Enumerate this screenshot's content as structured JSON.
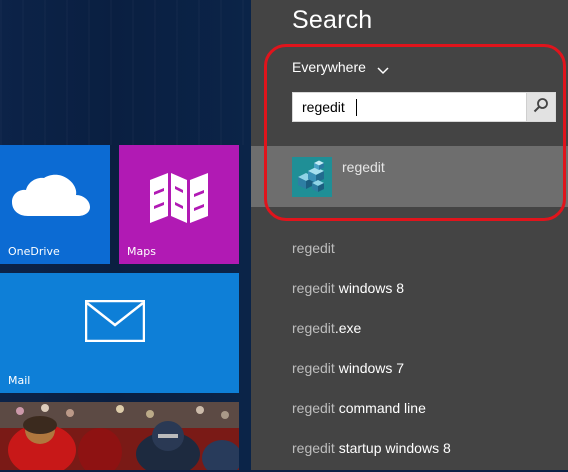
{
  "start_screen": {
    "tiles": [
      {
        "label": "OneDrive",
        "icon": "cloud-icon",
        "color": "#0c6bd3"
      },
      {
        "label": "Maps",
        "icon": "map-icon",
        "color": "#b11ab4"
      },
      {
        "label": "Mail",
        "icon": "envelope-icon",
        "color": "#0e7fd7"
      },
      {
        "label": "",
        "icon": "photo-image",
        "color": "#9b1010"
      }
    ]
  },
  "search_charm": {
    "title": "Search",
    "scope": "Everywhere",
    "query": "regedit",
    "search_button_icon": "search-icon",
    "best_match": {
      "label": "regedit",
      "icon": "registry-editor-icon"
    },
    "suggestions": [
      {
        "typed": "regedit",
        "rest": ""
      },
      {
        "typed": "regedit",
        "rest": " windows 8"
      },
      {
        "typed": "regedit",
        "rest": ".exe"
      },
      {
        "typed": "regedit",
        "rest": " windows 7"
      },
      {
        "typed": "regedit",
        "rest": " command line"
      },
      {
        "typed": "regedit",
        "rest": " startup windows 8"
      }
    ]
  },
  "colors": {
    "charm_background": "#444444",
    "best_match_highlight": "#6e6e6e",
    "annotation_red": "#e0141c"
  }
}
